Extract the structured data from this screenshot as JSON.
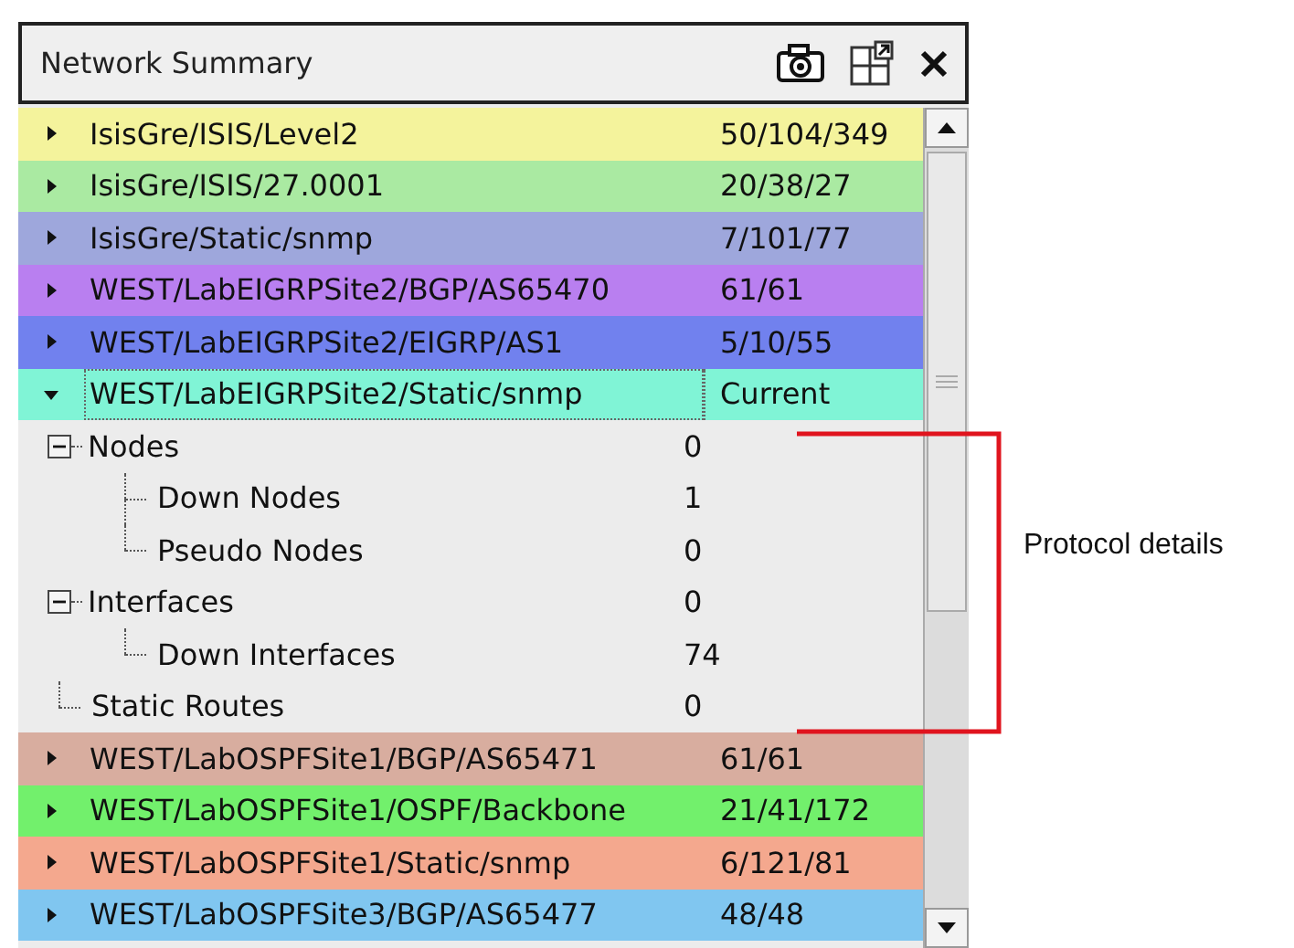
{
  "panel": {
    "title": "Network Summary"
  },
  "groups": [
    {
      "label": "IsisGre/ISIS/Level2",
      "value": "50/104/349",
      "color": "#f4f39c",
      "expanded": false
    },
    {
      "label": "IsisGre/ISIS/27.0001",
      "value": "20/38/27",
      "color": "#aaeaa2",
      "expanded": false
    },
    {
      "label": "IsisGre/Static/snmp",
      "value": "7/101/77",
      "color": "#9ea7dc",
      "expanded": false
    },
    {
      "label": "WEST/LabEIGRPSite2/BGP/AS65470",
      "value": "61/61",
      "color": "#b97ff0",
      "expanded": false
    },
    {
      "label": "WEST/LabEIGRPSite2/EIGRP/AS1",
      "value": "5/10/55",
      "color": "#7181ee",
      "expanded": false
    },
    {
      "label": "WEST/LabEIGRPSite2/Static/snmp",
      "value": "Current",
      "color": "#80f4d6",
      "expanded": true,
      "children": [
        {
          "label": "Nodes",
          "value": "0",
          "expanded": true,
          "children": [
            {
              "label": "Down Nodes",
              "value": "1"
            },
            {
              "label": "Pseudo Nodes",
              "value": "0"
            }
          ]
        },
        {
          "label": "Interfaces",
          "value": "0",
          "expanded": true,
          "children": [
            {
              "label": "Down Interfaces",
              "value": "74"
            }
          ]
        },
        {
          "label": "Static Routes",
          "value": "0"
        }
      ]
    },
    {
      "label": "WEST/LabOSPFSite1/BGP/AS65471",
      "value": "61/61",
      "color": "#d8ad9f",
      "expanded": false
    },
    {
      "label": "WEST/LabOSPFSite1/OSPF/Backbone",
      "value": "21/41/172",
      "color": "#72f06c",
      "expanded": false
    },
    {
      "label": "WEST/LabOSPFSite1/Static/snmp",
      "value": "6/121/81",
      "color": "#f4a88e",
      "expanded": false
    },
    {
      "label": "WEST/LabOSPFSite3/BGP/AS65477",
      "value": "48/48",
      "color": "#80c6f0",
      "expanded": false
    }
  ],
  "callout": {
    "label": "Protocol details"
  }
}
